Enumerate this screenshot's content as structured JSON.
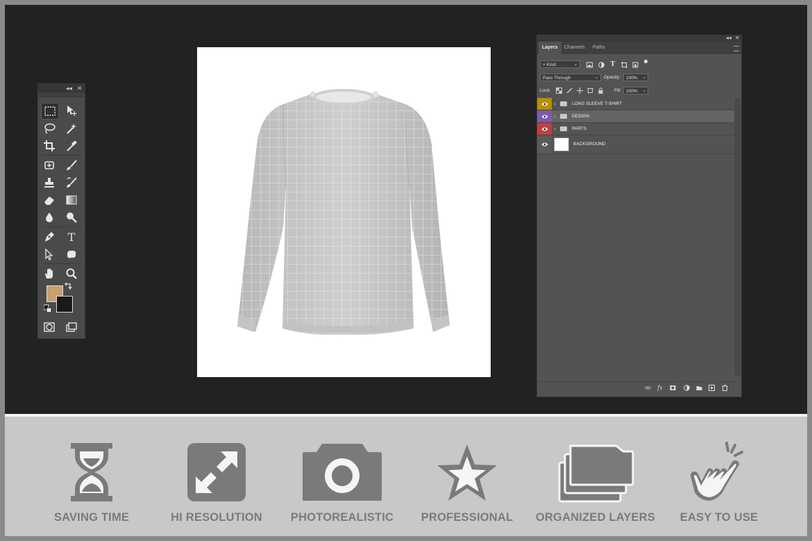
{
  "toolbox": {
    "collapse_glyph": "◂◂",
    "close_glyph": "✕",
    "foreground_color": "#c8a070",
    "background_color": "#1a1a1a",
    "tools": [
      "marquee-icon",
      "move-icon",
      "lasso-icon",
      "magic-wand-icon",
      "crop-icon",
      "eyedropper-icon",
      "healing-brush-icon",
      "brush-icon",
      "clone-stamp-icon",
      "history-brush-icon",
      "eraser-icon",
      "gradient-icon",
      "blur-icon",
      "dodge-icon",
      "pen-icon",
      "type-icon",
      "path-selection-icon",
      "shape-icon",
      "hand-icon",
      "zoom-icon",
      "quick-mask-icon",
      "screen-mode-icon"
    ],
    "type_tool_glyph": "T"
  },
  "layers_panel": {
    "collapse_glyph": "◂◂",
    "close_glyph": "✕",
    "tabs": [
      "Layers",
      "Channels",
      "Paths"
    ],
    "active_tab": "Layers",
    "filter_kind": "Kind",
    "blend_mode": "Pass Through",
    "opacity_label": "Opacity:",
    "opacity_value": "100%",
    "lock_label": "Lock:",
    "fill_label": "Fill:",
    "fill_value": "100%",
    "type_glyph": "T",
    "fx_glyph": "fx",
    "layers": [
      {
        "name": "LONG SLEEVE T-SHIRT",
        "eye_color": "#b89000",
        "kind": "group"
      },
      {
        "name": "DESIGN",
        "eye_color": "#7a5bb0",
        "kind": "group",
        "selected": true
      },
      {
        "name": "PARTS",
        "eye_color": "#c04040",
        "kind": "group"
      },
      {
        "name": "BACKGROUND",
        "eye_color": "#5a5a5a",
        "kind": "pixel"
      }
    ]
  },
  "features": [
    {
      "label": "SAVING TIME",
      "icon": "hourglass-icon"
    },
    {
      "label": "HI RESOLUTION",
      "icon": "expand-icon"
    },
    {
      "label": "PHOTOREALISTIC",
      "icon": "camera-icon"
    },
    {
      "label": "PROFESSIONAL",
      "icon": "star-icon"
    },
    {
      "label": "ORGANIZED LAYERS",
      "icon": "folders-icon"
    },
    {
      "label": "EASY TO USE",
      "icon": "tap-hand-icon"
    }
  ],
  "colors": {
    "workspace": "#222222",
    "panel": "#535353",
    "feature_bar": "#c8c8c8",
    "feature_text": "#7a7a7a"
  }
}
